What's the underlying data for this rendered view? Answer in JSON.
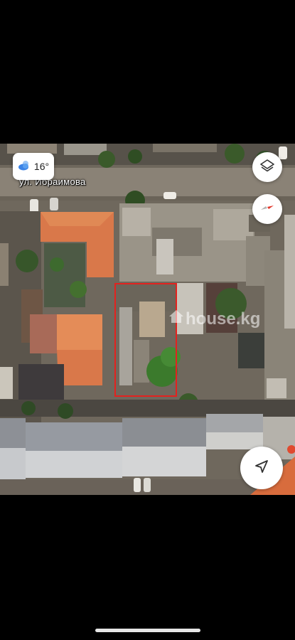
{
  "map": {
    "street_label": "ул. Ибраимова",
    "watermark": "house.kg"
  },
  "weather": {
    "temperature": "16°",
    "icon": "partly-cloudy-icon"
  },
  "controls": {
    "layers_icon": "layers-icon",
    "compass_icon": "compass-icon",
    "locate_icon": "navigation-arrow-icon"
  },
  "colors": {
    "parcel_outline": "#e3221f",
    "roof_orange": "#d9784a",
    "vegetation": "#3f6b2c"
  }
}
